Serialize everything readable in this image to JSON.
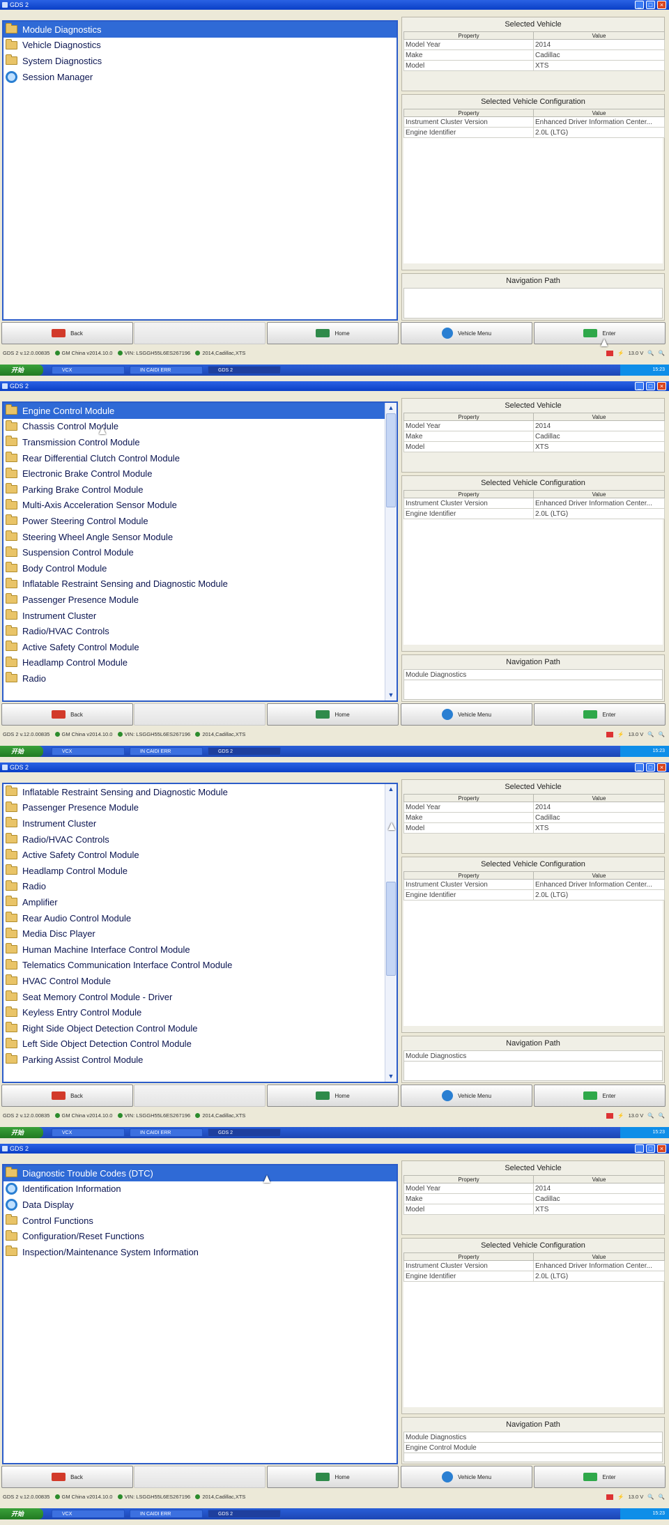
{
  "window_title": "GDS 2",
  "window_buttons": [
    "_",
    "□",
    "×"
  ],
  "panels": {
    "selected_vehicle": "Selected Vehicle",
    "selected_config": "Selected Vehicle Configuration",
    "navigation_path": "Navigation Path",
    "col_property": "Property",
    "col_value": "Value"
  },
  "vehicle_rows": [
    {
      "property": "Model Year",
      "value": "2014"
    },
    {
      "property": "Make",
      "value": "Cadillac"
    },
    {
      "property": "Model",
      "value": "XTS"
    }
  ],
  "config_rows": [
    {
      "property": "Instrument Cluster Version",
      "value": "Enhanced Driver Information Center..."
    },
    {
      "property": "Engine Identifier",
      "value": "2.0L (LTG)"
    }
  ],
  "buttons": {
    "back": "Back",
    "home": "Home",
    "vehicle_menu": "Vehicle Menu",
    "enter": "Enter"
  },
  "status": {
    "version": "GDS 2 v.12.0.00835",
    "db": "GM China v2014.10.0",
    "vin": "VIN: LSGGH55L6ES267196",
    "vehicle": "2014,Cadillac,XTS",
    "voltage": "13.0 V"
  },
  "taskbar": {
    "start": "开始",
    "tasks": [
      "VCX",
      "IN CAIDI ERR",
      "GDS 2"
    ],
    "clock": "15:23"
  },
  "screens": [
    {
      "items": [
        {
          "label": "Module Diagnostics",
          "icon": "folder-icon",
          "selected": true
        },
        {
          "label": "Vehicle Diagnostics",
          "icon": "folder-icon"
        },
        {
          "label": "System Diagnostics",
          "icon": "folder-icon"
        },
        {
          "label": "Session Manager",
          "icon": "gear-icon"
        }
      ],
      "nav_path": []
    },
    {
      "items": [
        {
          "label": "Engine Control Module",
          "icon": "folder-icon",
          "selected": true
        },
        {
          "label": "Chassis Control Module",
          "icon": "folder-icon"
        },
        {
          "label": "Transmission Control Module",
          "icon": "folder-icon"
        },
        {
          "label": "Rear Differential Clutch Control Module",
          "icon": "folder-icon"
        },
        {
          "label": "Electronic Brake Control Module",
          "icon": "folder-icon"
        },
        {
          "label": "Parking Brake Control Module",
          "icon": "folder-icon"
        },
        {
          "label": "Multi-Axis Acceleration Sensor Module",
          "icon": "folder-icon"
        },
        {
          "label": "Power Steering Control Module",
          "icon": "folder-icon"
        },
        {
          "label": "Steering Wheel Angle Sensor Module",
          "icon": "folder-icon"
        },
        {
          "label": "Suspension Control Module",
          "icon": "folder-icon"
        },
        {
          "label": "Body Control Module",
          "icon": "folder-icon"
        },
        {
          "label": "Inflatable Restraint Sensing and Diagnostic Module",
          "icon": "folder-icon"
        },
        {
          "label": "Passenger Presence Module",
          "icon": "folder-icon"
        },
        {
          "label": "Instrument Cluster",
          "icon": "folder-icon"
        },
        {
          "label": "Radio/HVAC Controls",
          "icon": "folder-icon"
        },
        {
          "label": "Active Safety Control Module",
          "icon": "folder-icon"
        },
        {
          "label": "Headlamp Control Module",
          "icon": "folder-icon"
        },
        {
          "label": "Radio",
          "icon": "folder-icon"
        }
      ],
      "nav_path": [
        "Module Diagnostics"
      ]
    },
    {
      "items": [
        {
          "label": "Inflatable Restraint Sensing and Diagnostic Module",
          "icon": "folder-icon"
        },
        {
          "label": "Passenger Presence Module",
          "icon": "folder-icon"
        },
        {
          "label": "Instrument Cluster",
          "icon": "folder-icon"
        },
        {
          "label": "Radio/HVAC Controls",
          "icon": "folder-icon"
        },
        {
          "label": "Active Safety Control Module",
          "icon": "folder-icon"
        },
        {
          "label": "Headlamp Control Module",
          "icon": "folder-icon"
        },
        {
          "label": "Radio",
          "icon": "folder-icon"
        },
        {
          "label": "Amplifier",
          "icon": "folder-icon"
        },
        {
          "label": "Rear Audio Control Module",
          "icon": "folder-icon"
        },
        {
          "label": "Media Disc Player",
          "icon": "folder-icon"
        },
        {
          "label": "Human Machine Interface Control Module",
          "icon": "folder-icon"
        },
        {
          "label": "Telematics Communication Interface Control Module",
          "icon": "folder-icon"
        },
        {
          "label": "HVAC Control Module",
          "icon": "folder-icon"
        },
        {
          "label": "Seat Memory Control Module - Driver",
          "icon": "folder-icon"
        },
        {
          "label": "Keyless Entry Control Module",
          "icon": "folder-icon"
        },
        {
          "label": "Right Side Object Detection Control Module",
          "icon": "folder-icon"
        },
        {
          "label": "Left Side Object Detection Control Module",
          "icon": "folder-icon"
        },
        {
          "label": "Parking Assist Control Module",
          "icon": "folder-icon"
        }
      ],
      "nav_path": [
        "Module Diagnostics"
      ]
    },
    {
      "items": [
        {
          "label": "Diagnostic Trouble Codes (DTC)",
          "icon": "folder-icon",
          "selected": true
        },
        {
          "label": "Identification Information",
          "icon": "gear-icon"
        },
        {
          "label": "Data Display",
          "icon": "gear-icon"
        },
        {
          "label": "Control Functions",
          "icon": "folder-icon"
        },
        {
          "label": "Configuration/Reset Functions",
          "icon": "folder-icon"
        },
        {
          "label": "Inspection/Maintenance System Information",
          "icon": "folder-icon"
        }
      ],
      "nav_path": [
        "Module Diagnostics",
        "Engine Control Module"
      ]
    }
  ]
}
